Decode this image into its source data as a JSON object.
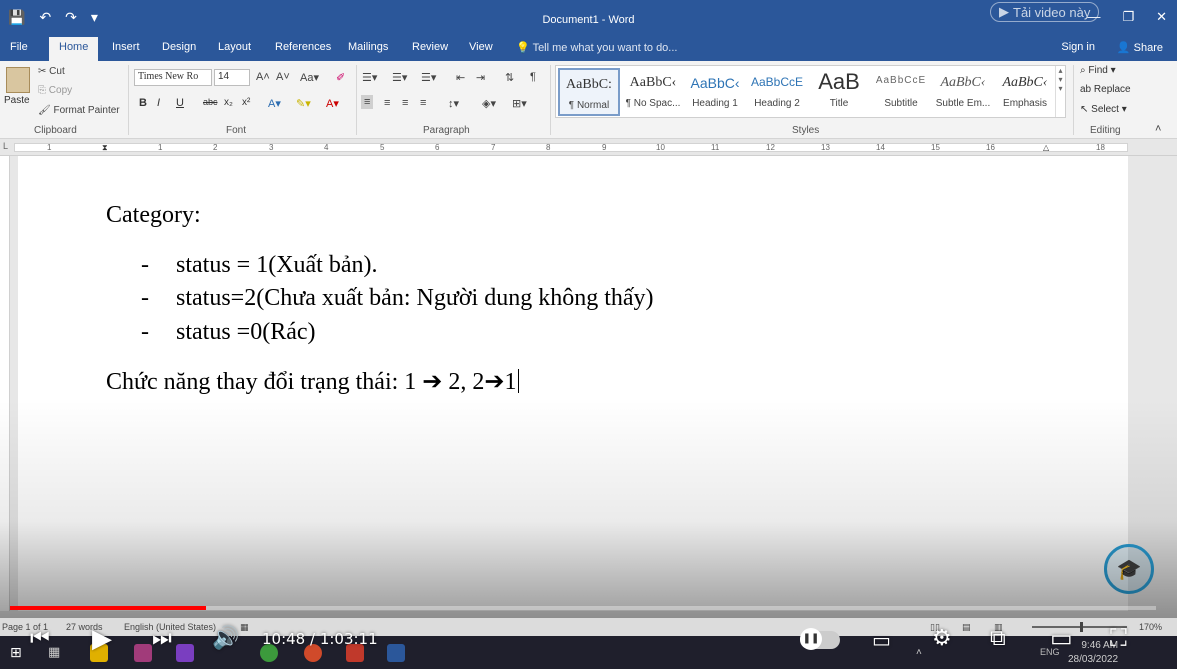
{
  "window": {
    "title": "Document1 - Word",
    "watch_label": "Tải video này",
    "controls": [
      "—",
      "❐",
      "✕"
    ]
  },
  "quick_access": [
    "💾",
    "↶",
    "↷",
    "▾"
  ],
  "tabs": [
    "File",
    "Home",
    "Insert",
    "Design",
    "Layout",
    "References",
    "Mailings",
    "Review",
    "View"
  ],
  "active_tab": "Home",
  "tell_me": "Tell me what you want to do...",
  "sign_in": "Sign in",
  "share": "Share",
  "ribbon": {
    "clipboard": {
      "paste": "Paste",
      "cut": "Cut",
      "copy": "Copy",
      "format_painter": "Format Painter",
      "label": "Clipboard"
    },
    "font": {
      "family": "Times New Ro",
      "size": "14",
      "label": "Font"
    },
    "paragraph": {
      "label": "Paragraph"
    },
    "styles": {
      "label": "Styles",
      "items": [
        {
          "preview": "AaBbC:",
          "name": "¶ Normal"
        },
        {
          "preview": "AaBbC‹",
          "name": "¶ No Spac..."
        },
        {
          "preview": "AaBbC‹",
          "name": "Heading 1"
        },
        {
          "preview": "AaBbCcE",
          "name": "Heading 2"
        },
        {
          "preview": "AaB",
          "name": "Title"
        },
        {
          "preview": "AaBbCcE",
          "name": "Subtitle"
        },
        {
          "preview": "AaBbC‹",
          "name": "Subtle Em..."
        },
        {
          "preview": "AaBbC‹",
          "name": "Emphasis"
        }
      ]
    },
    "editing": {
      "find": "Find",
      "replace": "Replace",
      "select": "Select",
      "label": "Editing"
    }
  },
  "ruler": [
    "1",
    "2",
    "3",
    "4",
    "5",
    "6",
    "7",
    "8",
    "9",
    "10",
    "11",
    "12",
    "13",
    "14",
    "15",
    "16",
    "18"
  ],
  "document": {
    "heading": "Category:",
    "bullets": [
      "status = 1(Xuất bản).",
      "status=2(Chưa xuất bản: Người dung không thấy)",
      "status =0(Rác)"
    ],
    "function_line": "Chức năng thay đổi trạng thái: 1 ➔ 2, 2➔1"
  },
  "statusbar": {
    "page": "Page 1 of 1",
    "words": "27 words",
    "language": "English (United States)",
    "zoom": "170%"
  },
  "video": {
    "time": "10:48 / 1:03:11",
    "progress": 0.171
  },
  "taskbar": {
    "clock_time": "9:46 AM",
    "clock_date": "28/03/2022",
    "lang": "ENG"
  }
}
